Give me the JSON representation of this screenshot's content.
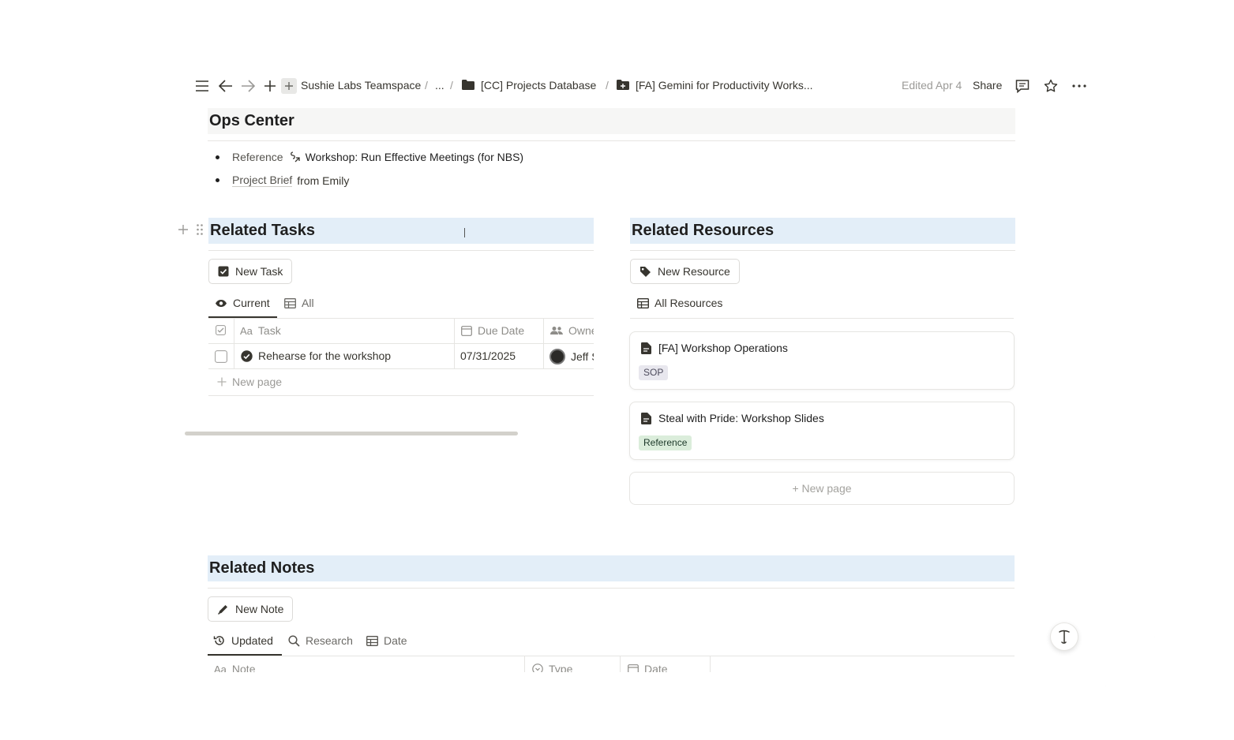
{
  "topbar": {
    "breadcrumb": [
      "Sushie Labs Teamspace",
      "...",
      "[CC] Projects Database",
      "[FA] Gemini for Productivity Works..."
    ],
    "edited": "Edited Apr 4",
    "share": "Share"
  },
  "ops": {
    "title": "Ops Center",
    "bullets": [
      {
        "prefix": "Reference",
        "link": "Workshop: Run Effective Meetings (for NBS)"
      },
      {
        "prefix": "Project Brief",
        "suffix": "from Emily"
      }
    ]
  },
  "tasks": {
    "title": "Related Tasks",
    "new_button": "New Task",
    "tabs": [
      "Current",
      "All"
    ],
    "columns": [
      "Task",
      "Due Date",
      "Owne"
    ],
    "rows": [
      {
        "task": "Rehearse for the workshop",
        "due": "07/31/2025",
        "owner": "Jeff S"
      }
    ],
    "new_page": "New page"
  },
  "resources": {
    "title": "Related Resources",
    "new_button": "New Resource",
    "view": "All Resources",
    "cards": [
      {
        "title": "[FA] Workshop Operations",
        "tag": "SOP",
        "tag_color": "#e8e7ee"
      },
      {
        "title": "Steal with Pride: Workshop Slides",
        "tag": "Reference",
        "tag_color": "#dbeddb"
      }
    ],
    "new_page": "+ New page"
  },
  "notes": {
    "title": "Related Notes",
    "new_button": "New Note",
    "tabs": [
      "Updated",
      "Research",
      "Date"
    ],
    "columns": [
      "Note",
      "Type",
      "Date"
    ]
  },
  "colors": {
    "header_bg": "#e3eef8",
    "ops_bg": "#f6f6f5",
    "text": "#37352f"
  }
}
